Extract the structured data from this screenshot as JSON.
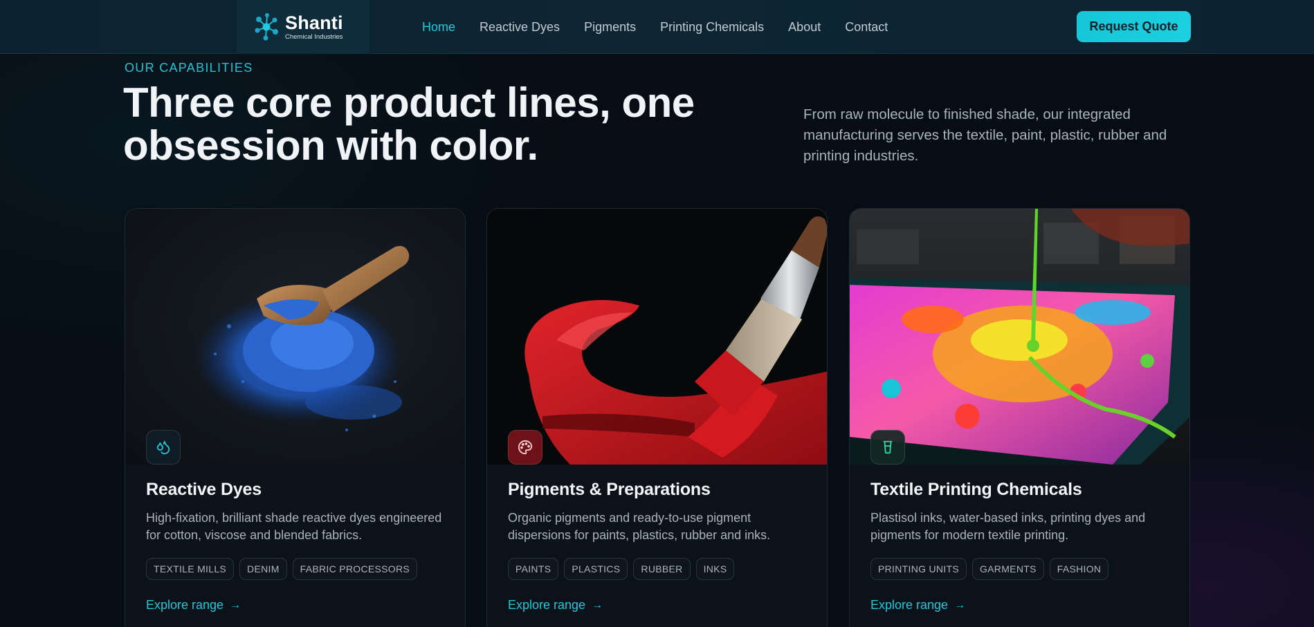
{
  "nav": {
    "brand": {
      "name": "Shanti",
      "subtitle": "Chemical Industries"
    },
    "links": [
      {
        "label": "Home",
        "active": true
      },
      {
        "label": "Reactive Dyes",
        "active": false
      },
      {
        "label": "Pigments",
        "active": false
      },
      {
        "label": "Printing Chemicals",
        "active": false
      },
      {
        "label": "About",
        "active": false
      },
      {
        "label": "Contact",
        "active": false
      }
    ],
    "cta_label": "Request Quote"
  },
  "section": {
    "eyebrow": "OUR CAPABILITIES",
    "headline": "Three core product lines, one obsession with color.",
    "intro": "From raw molecule to finished shade, our integrated manufacturing serves the textile, paint, plastic, rubber and printing industries."
  },
  "cards": [
    {
      "icon": "drop-icon",
      "title": "Reactive Dyes",
      "description": "High-fixation, brilliant shade reactive dyes engineered for cotton, viscose and blended fabrics.",
      "tags": [
        "TEXTILE MILLS",
        "DENIM",
        "FABRIC PROCESSORS"
      ],
      "link_label": "Explore range"
    },
    {
      "icon": "palette-icon",
      "title": "Pigments & Preparations",
      "description": "Organic pigments and ready-to-use pigment dispersions for paints, plastics, rubber and inks.",
      "tags": [
        "PAINTS",
        "PLASTICS",
        "RUBBER",
        "INKS"
      ],
      "link_label": "Explore range"
    },
    {
      "icon": "cup-icon",
      "title": "Textile Printing Chemicals",
      "description": "Plastisol inks, water-based inks, printing dyes and pigments for modern textile printing.",
      "tags": [
        "PRINTING UNITS",
        "GARMENTS",
        "FASHION"
      ],
      "link_label": "Explore range"
    }
  ],
  "colors": {
    "accent": "#22c8d8",
    "background": "#070d14",
    "nav_background": "#0c2230"
  }
}
